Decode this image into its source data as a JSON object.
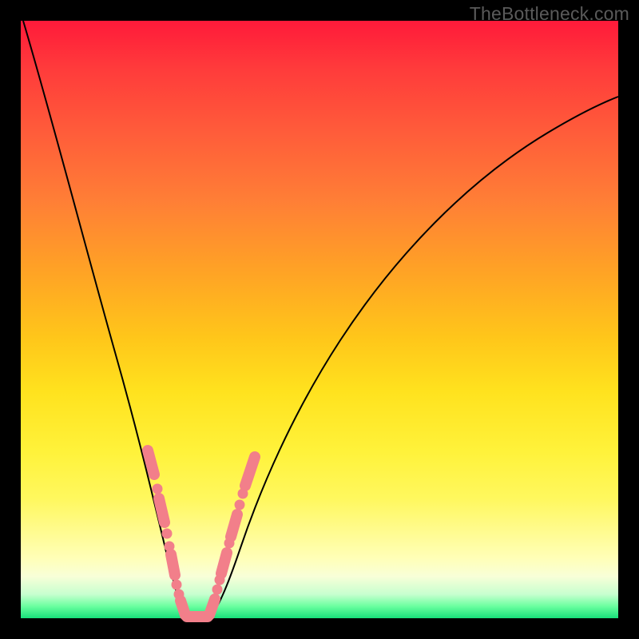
{
  "watermark": "TheBottleneck.com",
  "colors": {
    "frame_bg_top": "#ff1a3a",
    "frame_bg_bottom": "#18e07a",
    "curve": "#000000",
    "accent": "#f27f8a",
    "outer_bg": "#000000"
  },
  "chart_data": {
    "type": "line",
    "title": "",
    "xlabel": "",
    "ylabel": "",
    "xlim": [
      0,
      100
    ],
    "ylim": [
      0,
      100
    ],
    "grid": false,
    "legend": false,
    "description": "Bottleneck-style V-curve: two monotone branches meeting at a floor segment. Y-axis is inverted visually (low values at bottom correspond to best/green region).",
    "series": [
      {
        "name": "left-branch",
        "x": [
          0,
          3,
          6,
          9,
          12,
          15,
          17,
          19,
          21,
          22.5,
          24,
          25,
          25.5
        ],
        "values": [
          100,
          83,
          68,
          55,
          43,
          32,
          24,
          16,
          9,
          5,
          2,
          0.5,
          0
        ]
      },
      {
        "name": "floor",
        "x": [
          25.5,
          27,
          28.5,
          30,
          31.5
        ],
        "values": [
          0,
          0,
          0,
          0,
          0
        ]
      },
      {
        "name": "right-branch",
        "x": [
          31.5,
          33,
          35,
          38,
          42,
          48,
          55,
          63,
          72,
          82,
          92,
          100
        ],
        "values": [
          0,
          2,
          6,
          13,
          23,
          36,
          49,
          60,
          69,
          77,
          83,
          87
        ]
      }
    ],
    "highlight_band_y": [
      0,
      30
    ],
    "markers": {
      "name": "accent-points",
      "note": "Pink rounded segments and dots overlaid on the lower portion of both branches and along the floor.",
      "points": [
        {
          "x": 20.5,
          "y": 27
        },
        {
          "x": 21.2,
          "y": 24
        },
        {
          "x": 22.4,
          "y": 19
        },
        {
          "x": 23.2,
          "y": 15
        },
        {
          "x": 23.7,
          "y": 12
        },
        {
          "x": 24.3,
          "y": 9
        },
        {
          "x": 24.8,
          "y": 6.5
        },
        {
          "x": 25.2,
          "y": 4.5
        },
        {
          "x": 25.6,
          "y": 2.5
        },
        {
          "x": 26.3,
          "y": 1
        },
        {
          "x": 27.3,
          "y": 0
        },
        {
          "x": 28.5,
          "y": 0
        },
        {
          "x": 29.7,
          "y": 0
        },
        {
          "x": 30.7,
          "y": 0.5
        },
        {
          "x": 31.6,
          "y": 2
        },
        {
          "x": 32.3,
          "y": 4.5
        },
        {
          "x": 32.9,
          "y": 7
        },
        {
          "x": 33.5,
          "y": 10
        },
        {
          "x": 34.2,
          "y": 13.5
        },
        {
          "x": 35.0,
          "y": 17.5
        },
        {
          "x": 35.8,
          "y": 21
        },
        {
          "x": 36.9,
          "y": 26
        }
      ]
    }
  }
}
